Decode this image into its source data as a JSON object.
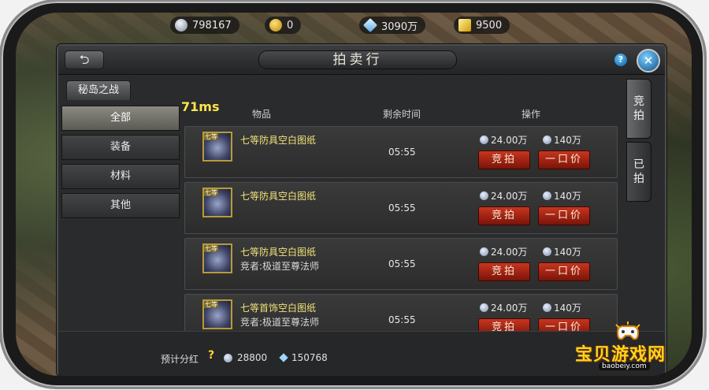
{
  "resources": [
    {
      "value": "798167",
      "icon": "silver-coin-icon",
      "color": "#c7d0dc"
    },
    {
      "value": "0",
      "icon": "gold-coin-icon",
      "color": "#f3c531"
    },
    {
      "value": "3090万",
      "icon": "diamond-icon",
      "color": "#a7d8ff"
    },
    {
      "value": "9500",
      "icon": "gold-ingot-icon",
      "color": "#ffcc00"
    }
  ],
  "header": {
    "back_label": "⮌",
    "title": "拍卖行",
    "help_label": "?",
    "close_label": "✕"
  },
  "region_tab": "秘岛之战",
  "categories": [
    "全部",
    "装备",
    "材料",
    "其他"
  ],
  "latency": "71ms",
  "columns": {
    "item": "物品",
    "time_left": "剩余时间",
    "action": "操作"
  },
  "items": [
    {
      "badge": "七等",
      "name": "七等防具空白图纸",
      "bidder": "",
      "time": "05:55",
      "bid_price": "24.00万",
      "buyout_price": "140万",
      "bid_label": "竞拍",
      "buyout_label": "一口价"
    },
    {
      "badge": "七等",
      "name": "七等防具空白图纸",
      "bidder": "",
      "time": "05:55",
      "bid_price": "24.00万",
      "buyout_price": "140万",
      "bid_label": "竞拍",
      "buyout_label": "一口价"
    },
    {
      "badge": "七等",
      "name": "七等防具空白图纸",
      "bidder": "竞者:极道至尊法师",
      "time": "05:55",
      "bid_price": "24.00万",
      "buyout_price": "140万",
      "bid_label": "竞拍",
      "buyout_label": "一口价"
    },
    {
      "badge": "七等",
      "name": "七等首饰空白图纸",
      "bidder": "竞者:极道至尊法师",
      "time": "05:55",
      "bid_price": "24.00万",
      "buyout_price": "140万",
      "bid_label": "竞拍",
      "buyout_label": "一口价"
    }
  ],
  "footer": {
    "label": "预计分红",
    "help": "?",
    "silver": "28800",
    "diamonds": "150768"
  },
  "side_tabs": [
    "竞拍",
    "已拍"
  ],
  "watermark": {
    "text": "宝贝游戏网",
    "url": "baobeiy.com"
  },
  "colors": {
    "accent_red": "#b02a17",
    "name_yellow": "#f0e27a",
    "latency_yellow": "#ffe54a"
  }
}
